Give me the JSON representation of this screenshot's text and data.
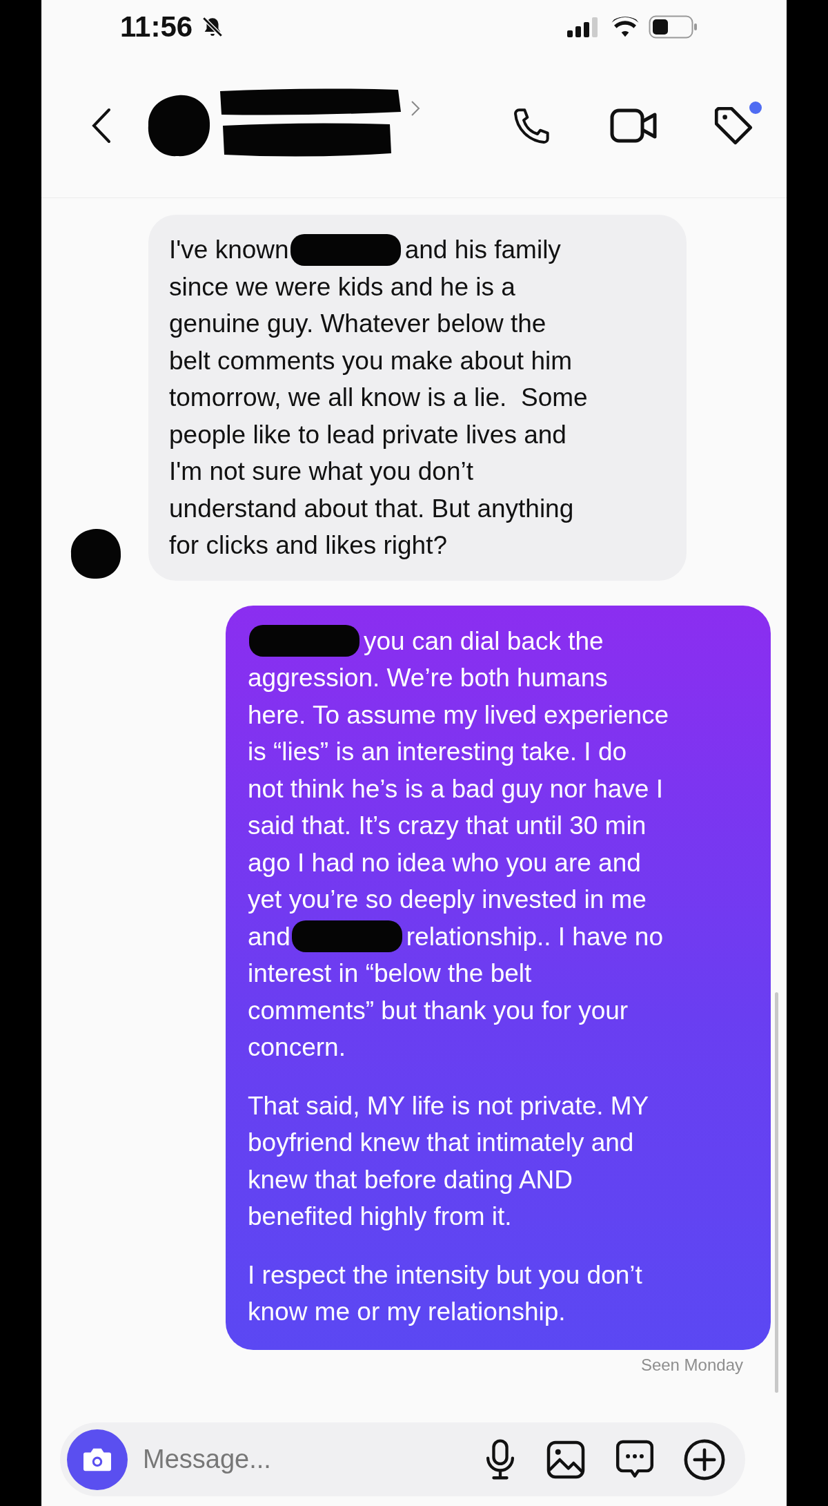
{
  "status_bar": {
    "time": "11:56"
  },
  "header": {
    "tag_badge": true
  },
  "messages": [
    {
      "outgoing": false,
      "paragraphs": [
        [
          [
            {
              "kind": "text",
              "text": "I've known"
            },
            {
              "kind": "redacted"
            },
            {
              "kind": "text",
              "text": "and his family"
            }
          ],
          [
            {
              "kind": "text",
              "text": "since we were kids and he is a"
            }
          ],
          [
            {
              "kind": "text",
              "text": "genuine guy. Whatever below the"
            }
          ],
          [
            {
              "kind": "text",
              "text": "belt comments you make about him"
            }
          ],
          [
            {
              "kind": "text",
              "text": "tomorrow, we all know is a lie.  Some"
            }
          ],
          [
            {
              "kind": "text",
              "text": "people like to lead private lives and"
            }
          ],
          [
            {
              "kind": "text",
              "text": "I'm not sure what you don’t"
            }
          ],
          [
            {
              "kind": "text",
              "text": "understand about that. But anything"
            }
          ],
          [
            {
              "kind": "text",
              "text": "for clicks and likes right?"
            }
          ]
        ]
      ]
    },
    {
      "outgoing": true,
      "paragraphs": [
        [
          [
            {
              "kind": "redacted"
            },
            {
              "kind": "text",
              "text": "you can dial back the"
            }
          ],
          [
            {
              "kind": "text",
              "text": "aggression. We’re both humans"
            }
          ],
          [
            {
              "kind": "text",
              "text": "here. To assume my lived experience"
            }
          ],
          [
            {
              "kind": "text",
              "text": "is “lies” is an interesting take. I do"
            }
          ],
          [
            {
              "kind": "text",
              "text": "not think he’s is a bad guy nor have I"
            }
          ],
          [
            {
              "kind": "text",
              "text": "said that. It’s crazy that until 30 min"
            }
          ],
          [
            {
              "kind": "text",
              "text": "ago I had no idea who you are and"
            }
          ],
          [
            {
              "kind": "text",
              "text": "yet you’re so deeply invested in me"
            }
          ],
          [
            {
              "kind": "text",
              "text": "and"
            },
            {
              "kind": "redacted"
            },
            {
              "kind": "text",
              "text": "relationship.. I have no"
            }
          ],
          [
            {
              "kind": "text",
              "text": "interest in “below the belt"
            }
          ],
          [
            {
              "kind": "text",
              "text": "comments” but thank you for your"
            }
          ],
          [
            {
              "kind": "text",
              "text": "concern."
            }
          ]
        ],
        [
          [
            {
              "kind": "text",
              "text": "That said, MY life is not private. MY"
            }
          ],
          [
            {
              "kind": "text",
              "text": "boyfriend knew that intimately and"
            }
          ],
          [
            {
              "kind": "text",
              "text": "knew that before dating AND"
            }
          ],
          [
            {
              "kind": "text",
              "text": "benefited highly from it."
            }
          ]
        ],
        [
          [
            {
              "kind": "text",
              "text": "I respect the intensity but you don’t"
            }
          ],
          [
            {
              "kind": "text",
              "text": "know me or my relationship."
            }
          ]
        ]
      ]
    }
  ],
  "seen": "Seen Monday",
  "composer": {
    "placeholder": "Message..."
  }
}
